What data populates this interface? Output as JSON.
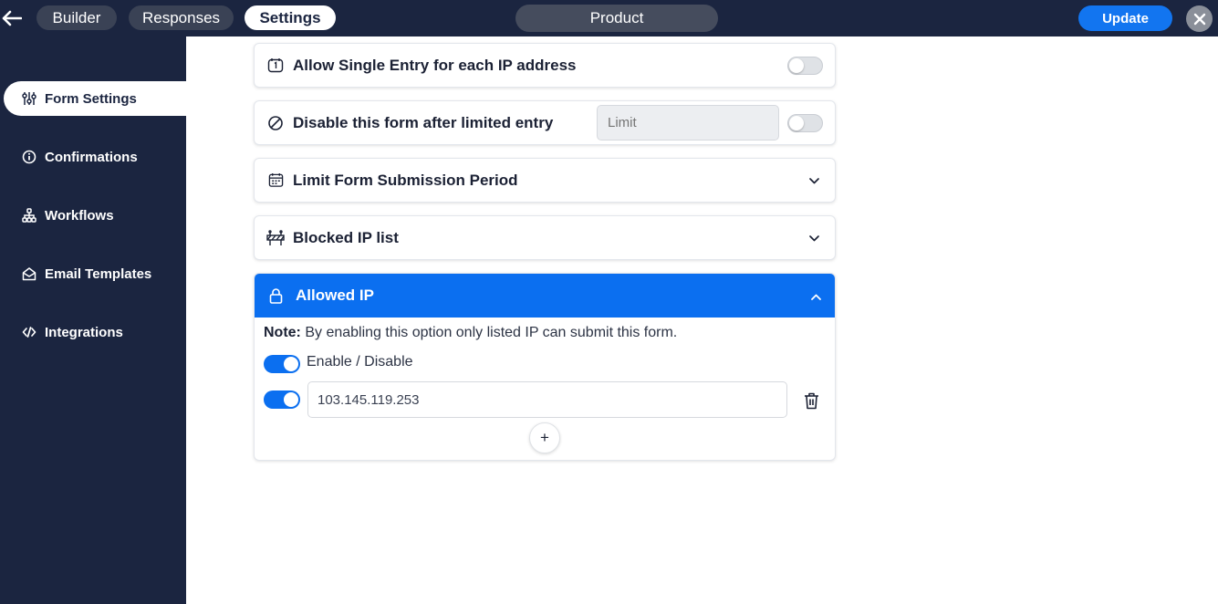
{
  "topbar": {
    "tabs": [
      {
        "label": "Builder"
      },
      {
        "label": "Responses"
      },
      {
        "label": "Settings"
      }
    ],
    "product_label": "Product",
    "update_label": "Update"
  },
  "sidebar": {
    "items": [
      {
        "label": "Form Settings",
        "icon": "sliders-icon",
        "active": true
      },
      {
        "label": "Confirmations",
        "icon": "info-icon"
      },
      {
        "label": "Workflows",
        "icon": "workflow-icon"
      },
      {
        "label": "Email Templates",
        "icon": "envelope-open-icon"
      },
      {
        "label": "Integrations",
        "icon": "code-icon"
      }
    ]
  },
  "settings": {
    "single_entry": {
      "title": "Allow Single Entry for each IP address",
      "enabled": false
    },
    "limited_entry": {
      "title": "Disable this form after limited entry",
      "limit_placeholder": "Limit",
      "enabled": false
    },
    "submission_period": {
      "title": "Limit Form Submission Period",
      "expanded": false
    },
    "blocked_ip": {
      "title": "Blocked IP list",
      "expanded": false
    },
    "allowed_ip": {
      "title": "Allowed IP",
      "expanded": true,
      "note_label": "Note:",
      "note_text": " By enabling this option only listed IP can submit this form.",
      "toggle_label": "Enable / Disable",
      "enabled": true,
      "entries": [
        {
          "ip": "103.145.119.253",
          "enabled": true
        }
      ],
      "add_label": "+"
    }
  },
  "colors": {
    "navy": "#1b2540",
    "accent": "#0b6ff0",
    "update": "#1275f0"
  }
}
